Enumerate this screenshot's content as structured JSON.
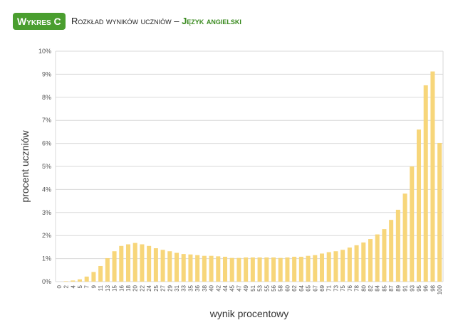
{
  "badge": {
    "label": "Wykres C",
    "color": "#4a9e2f"
  },
  "title": {
    "main": "Rozkład wyników uczniów – ",
    "subject": "Język angielski",
    "subject_color": "#3a8a1f"
  },
  "chart_data": {
    "type": "bar",
    "xlabel": "wynik procentowy",
    "ylabel": "procent uczniów",
    "ylim": [
      0,
      10
    ],
    "yticks": [
      "0%",
      "1%",
      "2%",
      "3%",
      "4%",
      "5%",
      "6%",
      "7%",
      "8%",
      "9%",
      "10%"
    ],
    "grid": true,
    "bar_color": "#f7d67a",
    "categories": [
      "0",
      "2",
      "4",
      "5",
      "7",
      "9",
      "11",
      "13",
      "15",
      "16",
      "18",
      "20",
      "22",
      "24",
      "25",
      "27",
      "29",
      "31",
      "33",
      "35",
      "36",
      "38",
      "40",
      "42",
      "44",
      "45",
      "47",
      "49",
      "51",
      "53",
      "55",
      "56",
      "58",
      "60",
      "62",
      "64",
      "65",
      "67",
      "69",
      "71",
      "73",
      "75",
      "76",
      "78",
      "80",
      "82",
      "84",
      "85",
      "87",
      "89",
      "91",
      "93",
      "95",
      "96",
      "98",
      "100"
    ],
    "values": [
      0.0,
      0.02,
      0.05,
      0.1,
      0.22,
      0.42,
      0.68,
      1.02,
      1.32,
      1.55,
      1.62,
      1.68,
      1.62,
      1.55,
      1.45,
      1.38,
      1.32,
      1.25,
      1.2,
      1.18,
      1.15,
      1.12,
      1.12,
      1.1,
      1.08,
      1.03,
      1.03,
      1.05,
      1.05,
      1.05,
      1.05,
      1.05,
      1.03,
      1.05,
      1.08,
      1.08,
      1.12,
      1.15,
      1.22,
      1.28,
      1.32,
      1.38,
      1.48,
      1.58,
      1.7,
      1.85,
      2.05,
      2.28,
      2.68,
      3.12,
      3.82,
      5.0,
      6.6,
      8.52,
      9.12,
      6.02
    ]
  }
}
